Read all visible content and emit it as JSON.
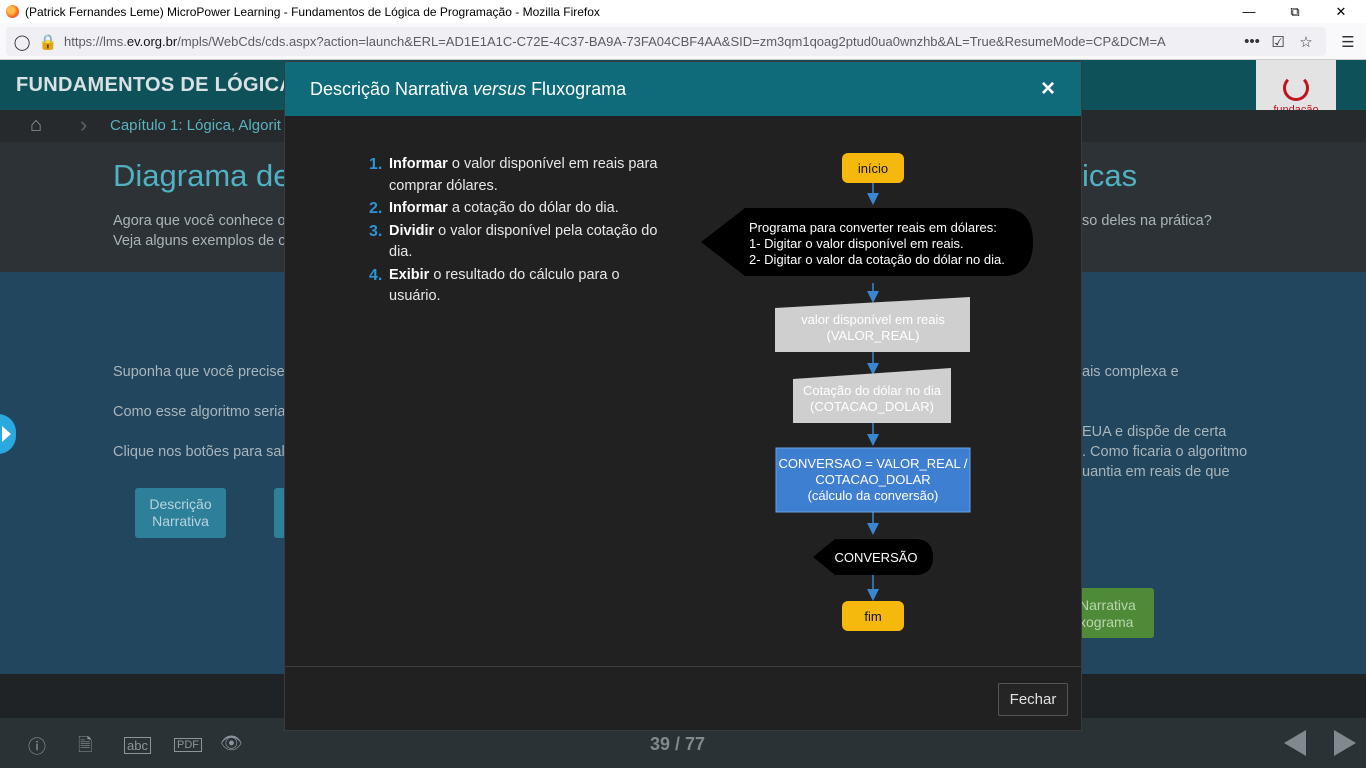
{
  "browser": {
    "window_title": "(Patrick Fernandes Leme) MicroPower Learning - Fundamentos de Lógica de Programação - Mozilla Firefox",
    "url_prefix": "https://lms.",
    "url_domain": "ev.org.br",
    "url_rest": "/mpls/WebCds/cds.aspx?action=launch&ERL=AD1E1A1C-C72E-4C37-BA9A-73FA04CBF4AA&SID=zm3qm1qoag2ptud0ua0wnzhb&AL=True&ResumeMode=CP&DCM=A",
    "more_icon": "•••"
  },
  "app": {
    "title": "FUNDAMENTOS DE LÓGICA",
    "logo_line1": "fundação",
    "logo_line2": "bradesco",
    "breadcrumb": "Capítulo 1: Lógica, Algorit"
  },
  "lesson": {
    "heading_left": "Diagrama de",
    "heading_right": "icas",
    "intro_line1": "Agora que você conhece o",
    "intro_line1_right": "so deles na prática?",
    "intro_line2": "Veja alguns exemplos de c",
    "para1_left": "Suponha que você precise",
    "para1_right": "ais complexa e",
    "para2_left": "Como esse algoritmo seria",
    "para3_left": "Clique nos botões para sal",
    "para_r1": "EUA e dispõe de certa",
    "para_r2": ". Como ficaria o algoritmo",
    "para_r3": "uantia em reais de que",
    "btn_descricao_l1": "Descrição",
    "btn_descricao_l2": "Narrativa",
    "btn_green_l1": "Narrativa",
    "btn_green_l2": "xograma"
  },
  "footer": {
    "page_indicator": "39 / 77"
  },
  "modal": {
    "title_pre": "Descrição Narrativa ",
    "title_em": "versus",
    "title_post": " Fluxograma",
    "close_label": "×",
    "close_button": "Fechar",
    "steps": [
      {
        "num": "1.",
        "verb": "Informar",
        "rest": " o valor disponível em reais para comprar dólares."
      },
      {
        "num": "2.",
        "verb": "Informar",
        "rest": " a cotação do dólar do dia."
      },
      {
        "num": "3.",
        "verb": "Dividir",
        "rest": " o valor disponível pela cotação do dia."
      },
      {
        "num": "4.",
        "verb": "Exibir",
        "rest": " o resultado do cálculo para o usuário."
      }
    ],
    "flow": {
      "start": "início",
      "display1_l1": "Programa para converter reais em dólares:",
      "display1_l2": "1- Digitar o valor disponível em reais.",
      "display1_l3": "2- Digitar o valor da cotação do dólar no dia.",
      "input1_l1": "valor disponível em reais",
      "input1_l2": "(VALOR_REAL)",
      "input2_l1": "Cotação do dólar no dia",
      "input2_l2": "(COTACAO_DOLAR)",
      "process_l1": "CONVERSAO = VALOR_REAL /",
      "process_l2": "COTACAO_DOLAR",
      "process_l3": "(cálculo da conversão)",
      "display2": "CONVERSÃO",
      "end": "fim"
    }
  }
}
